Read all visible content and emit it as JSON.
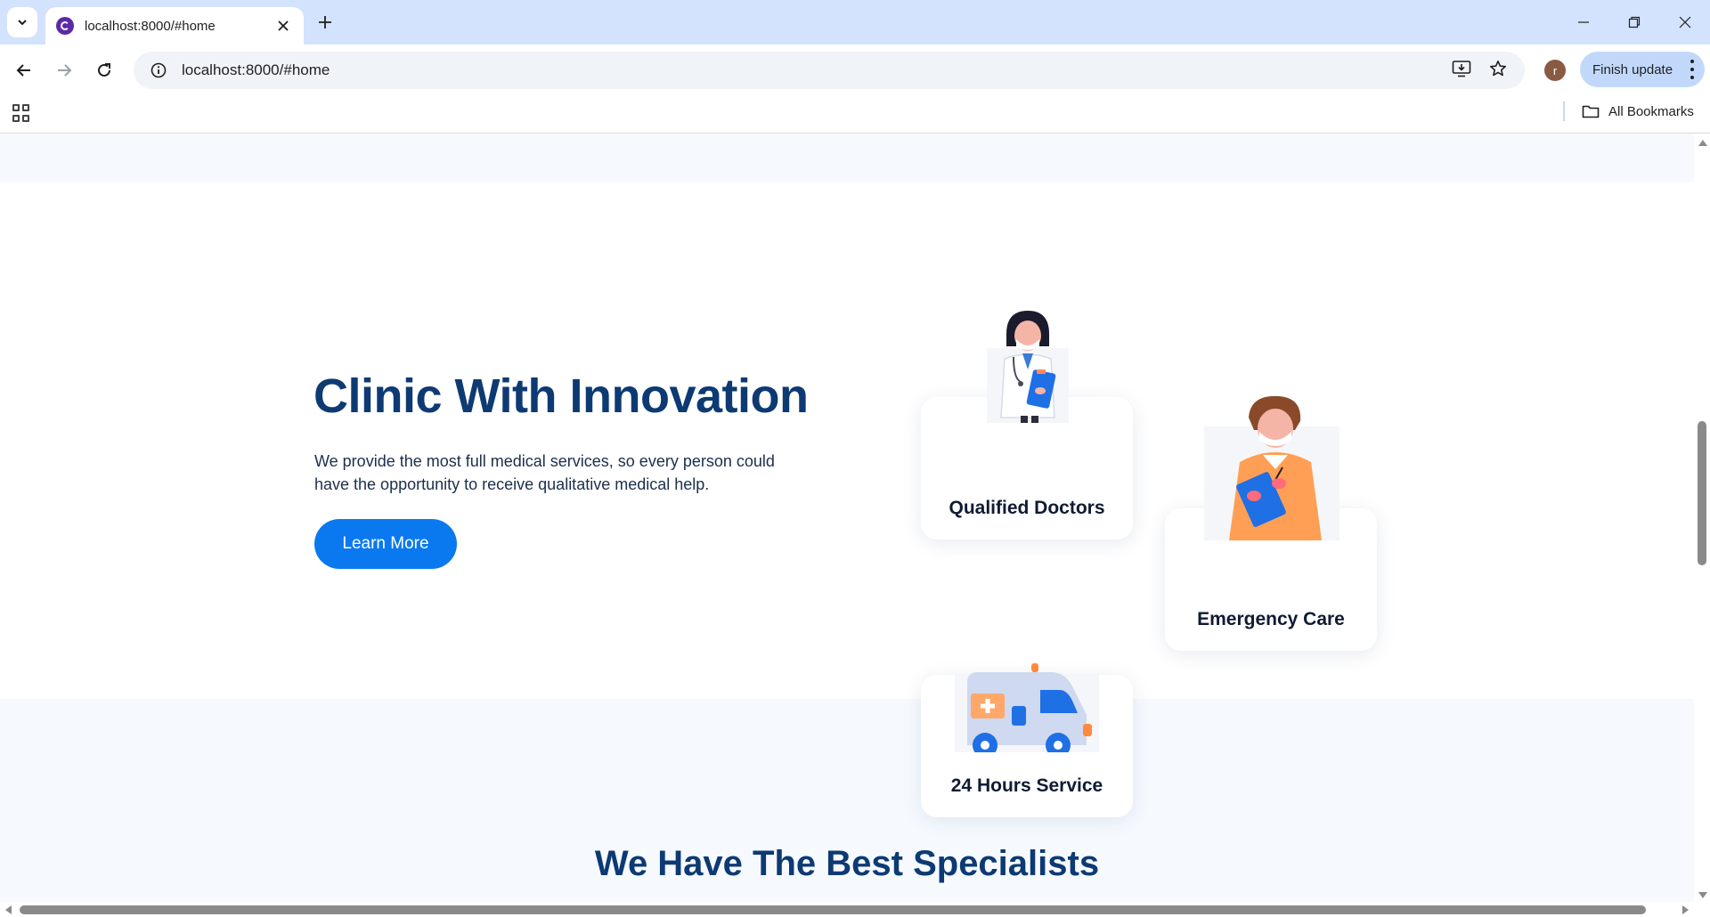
{
  "browser": {
    "tab_title": "localhost:8000/#home",
    "url": "localhost:8000/#home",
    "profile_initial": "r",
    "finish_update_label": "Finish update",
    "all_bookmarks_label": "All Bookmarks"
  },
  "hero": {
    "title": "Clinic With Innovation",
    "description": "We provide the most full medical services, so every person could have the opportunity to receive qualitative medical help.",
    "button_label": "Learn More"
  },
  "services": [
    {
      "label": "Qualified Doctors",
      "icon": "female-doctor-illustration"
    },
    {
      "label": "Emergency Care",
      "icon": "male-nurse-illustration"
    },
    {
      "label": "24 Hours Service",
      "icon": "ambulance-illustration"
    }
  ],
  "specialists": {
    "title": "We Have The Best Specialists"
  },
  "colors": {
    "accent": "#0a79f0",
    "heading": "#0d3a73",
    "tabstrip": "#d3e3fd",
    "section_bg": "#f6faff"
  }
}
